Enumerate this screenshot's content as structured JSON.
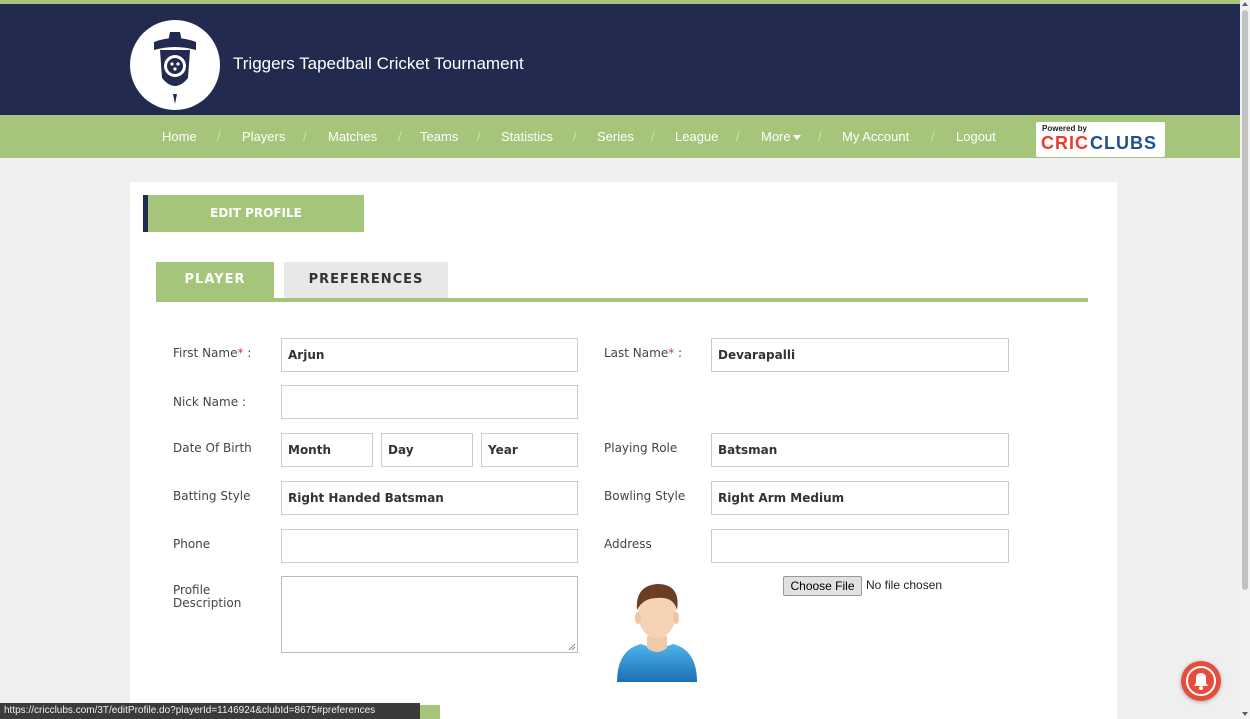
{
  "header": {
    "site_title": "Triggers Tapedball Cricket Tournament"
  },
  "nav": {
    "items": [
      {
        "label": "Home"
      },
      {
        "label": "Players"
      },
      {
        "label": "Matches"
      },
      {
        "label": "Teams"
      },
      {
        "label": "Statistics"
      },
      {
        "label": "Series"
      },
      {
        "label": "League"
      },
      {
        "label": "More"
      },
      {
        "label": "My Account"
      },
      {
        "label": "Logout"
      }
    ],
    "separator": "/",
    "powered_by": "Powered by",
    "brand_part1": "CRIC",
    "brand_part2": "CLUBS"
  },
  "page": {
    "edit_profile_label": "EDIT PROFILE",
    "tabs": [
      {
        "label": "PLAYER",
        "active": true
      },
      {
        "label": "PREFERENCES",
        "active": false
      }
    ]
  },
  "form": {
    "first_name": {
      "label": "First Name",
      "required_mark": "*",
      "suffix": " :",
      "value": "Arjun"
    },
    "last_name": {
      "label": "Last Name",
      "required_mark": "*",
      "suffix": " :",
      "value": "Devarapalli"
    },
    "nick_name": {
      "label": "Nick Name :",
      "value": ""
    },
    "dob": {
      "label": "Date Of Birth",
      "month": "Month",
      "day": "Day",
      "year": "Year"
    },
    "playing_role": {
      "label": "Playing Role",
      "value": "Batsman"
    },
    "batting_style": {
      "label": "Batting Style",
      "value": "Right Handed Batsman"
    },
    "bowling_style": {
      "label": "Bowling Style",
      "value": "Right Arm Medium"
    },
    "phone": {
      "label": "Phone",
      "value": ""
    },
    "address": {
      "label": "Address",
      "value": ""
    },
    "profile_description": {
      "label_line1": "Profile",
      "label_line2": "Description"
    },
    "file": {
      "button": "Choose File",
      "status": "No file chosen"
    }
  },
  "statusbar": {
    "url": "https://cricclubs.com/3T/editProfile.do?playerId=1146924&clubId=8675#preferences"
  },
  "colors": {
    "header_navy": "#222b4f",
    "accent_green": "#a5c57a",
    "required_red": "#e53935",
    "bell_red": "#e74c3c"
  },
  "icons": [
    "logo-shield-icon",
    "caret-down-icon",
    "user-avatar-icon",
    "notification-bell-icon"
  ]
}
